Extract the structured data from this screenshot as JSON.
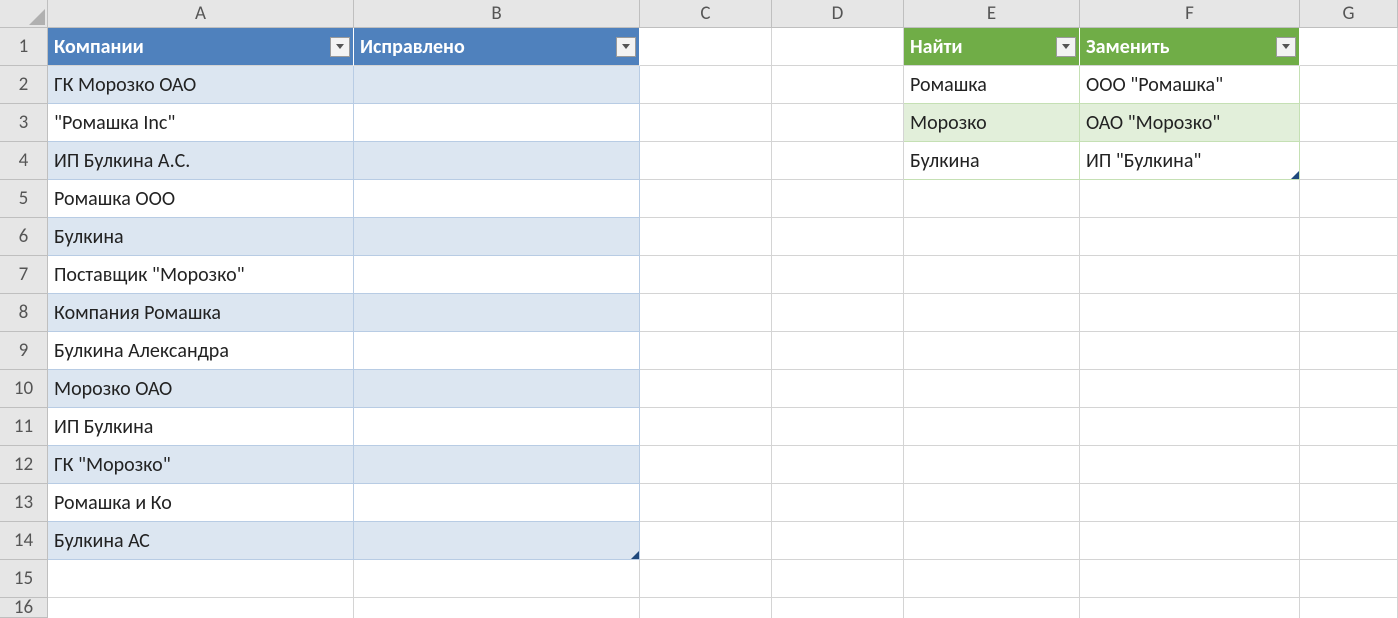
{
  "columns": [
    "A",
    "B",
    "C",
    "D",
    "E",
    "F",
    "G"
  ],
  "rows": [
    "1",
    "2",
    "3",
    "4",
    "5",
    "6",
    "7",
    "8",
    "9",
    "10",
    "11",
    "12",
    "13",
    "14",
    "15",
    "16"
  ],
  "blueTable": {
    "headers": {
      "A": "Компании",
      "B": "Исправлено"
    },
    "data": [
      "ГК Морозко ОАО",
      "\"Ромашка Inc\"",
      "ИП Булкина А.С.",
      "Ромашка ООО",
      "Булкина",
      "Поставщик \"Морозко\"",
      "Компания Ромашка",
      "Булкина Александра",
      "Морозко ОАО",
      "ИП Булкина",
      "ГК \"Морозко\"",
      "Ромашка и Ко",
      "Булкина АС"
    ]
  },
  "greenTable": {
    "headers": {
      "E": "Найти",
      "F": "Заменить"
    },
    "data": [
      {
        "find": "Ромашка",
        "replace": "ООО \"Ромашка\""
      },
      {
        "find": "Морозко",
        "replace": "ОАО \"Морозко\""
      },
      {
        "find": "Булкина",
        "replace": "ИП \"Булкина\""
      }
    ]
  }
}
